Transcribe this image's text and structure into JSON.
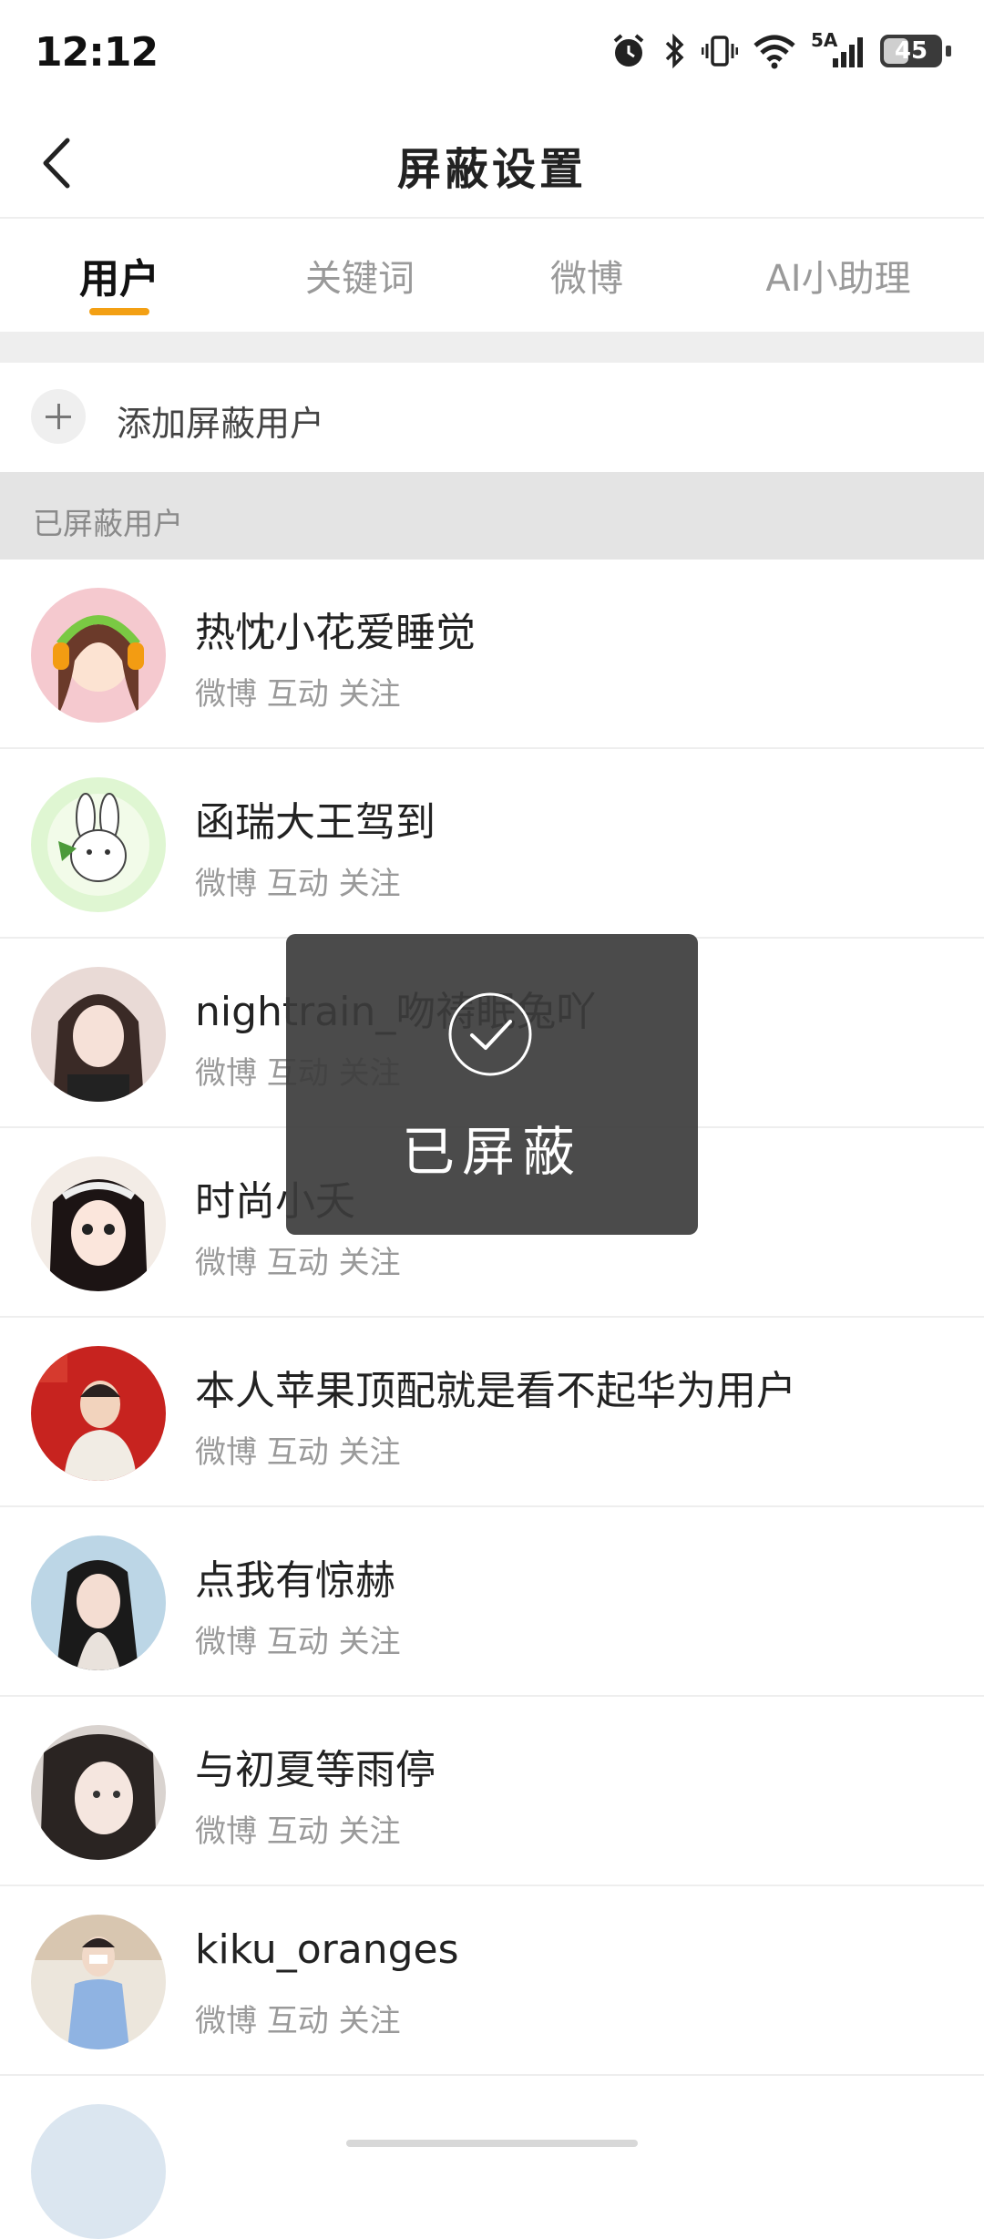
{
  "status_bar": {
    "time": "12:12",
    "network": "5A",
    "battery": "45",
    "battery_level": 0.45
  },
  "header": {
    "title": "屏蔽设置"
  },
  "tabs": [
    {
      "label": "用户",
      "active": true
    },
    {
      "label": "关键词",
      "active": false
    },
    {
      "label": "微博",
      "active": false
    },
    {
      "label": "AI小助理",
      "active": false
    }
  ],
  "add_row": {
    "label": "添加屏蔽用户"
  },
  "section": {
    "title": "已屏蔽用户"
  },
  "blocked_users": [
    {
      "name": "热忱小花爱睡觉",
      "scope": "微博 互动 关注"
    },
    {
      "name": "函瑞大王驾到",
      "scope": "微博 互动 关注"
    },
    {
      "name": "nightrain_吻祷眠兔吖",
      "scope": "微博 互动 关注"
    },
    {
      "name": "时尚小夭",
      "scope": "微博 互动 关注"
    },
    {
      "name": "本人苹果顶配就是看不起华为用户",
      "scope": "微博 互动 关注"
    },
    {
      "name": "点我有惊赫",
      "scope": "微博 互动 关注"
    },
    {
      "name": "与初夏等雨停",
      "scope": "微博 互动 关注"
    },
    {
      "name": "kiku_oranges",
      "scope": "微博 互动 关注"
    }
  ],
  "toast": {
    "text": "已屏蔽",
    "icon": "check-circle-icon"
  },
  "colors": {
    "accent": "#f3a014",
    "section_bg": "#e4e4e4",
    "toast_bg": "#3c3c3c"
  }
}
